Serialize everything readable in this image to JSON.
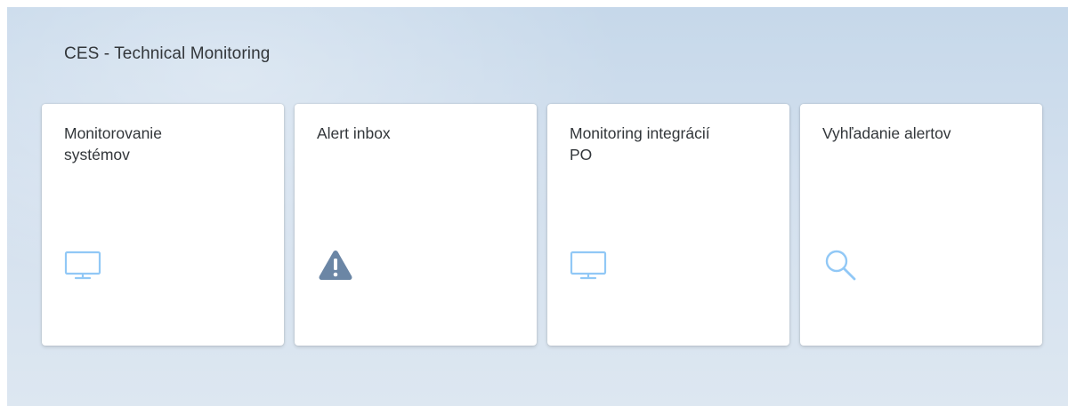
{
  "group": {
    "title": "CES - Technical Monitoring"
  },
  "tiles": [
    {
      "title": "Monitorovanie\nsystémov",
      "icon": "monitor-icon"
    },
    {
      "title": "Alert inbox",
      "icon": "warning-icon"
    },
    {
      "title": "Monitoring integrácií\nPO",
      "icon": "monitor-icon"
    },
    {
      "title": "Vyhľadanie alertov",
      "icon": "search-icon"
    }
  ],
  "colors": {
    "icon": "#91c8f6",
    "warning_icon": "#6b86a5",
    "text": "#32363a"
  }
}
